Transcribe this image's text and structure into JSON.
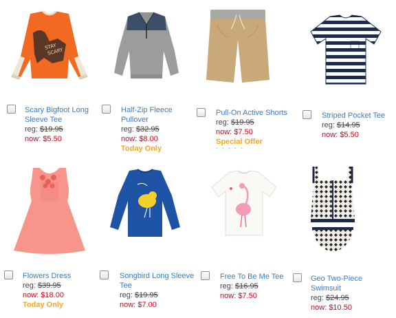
{
  "products": [
    {
      "name": "Scary Bigfoot Long Sleeve Tee",
      "reg_label": "reg:",
      "reg_price": "$19.95",
      "now_label": "now:",
      "now_price": "$5.50",
      "promo": ""
    },
    {
      "name": "Half-Zip Fleece Pullover",
      "reg_label": "reg:",
      "reg_price": "$32.95",
      "now_label": "now:",
      "now_price": "$8.00",
      "promo": "Today Only"
    },
    {
      "name": "Pull-On Active Shorts",
      "reg_label": "reg:",
      "reg_price": "$19.95",
      "now_label": "now:",
      "now_price": "$7.50",
      "promo": "Special Offer"
    },
    {
      "name": "Striped Pocket Tee",
      "reg_label": "reg:",
      "reg_price": "$14.95",
      "now_label": "now:",
      "now_price": "$5.50",
      "promo": ""
    },
    {
      "name": "Flowers Dress",
      "reg_label": "reg:",
      "reg_price": "$39.95",
      "now_label": "now:",
      "now_price": "$18.00",
      "promo": "Today Only"
    },
    {
      "name": "Songbird Long Sleeve Tee",
      "reg_label": "reg:",
      "reg_price": "$19.95",
      "now_label": "now:",
      "now_price": "$7.00",
      "promo": ""
    },
    {
      "name": "Free To Be Me Tee",
      "reg_label": "reg:",
      "reg_price": "$16.95",
      "now_label": "now:",
      "now_price": "$7.50",
      "promo": ""
    },
    {
      "name": "Geo Two-Piece Swimsuit",
      "reg_label": "reg:",
      "reg_price": "$24.95",
      "now_label": "now:",
      "now_price": "$10.50",
      "promo": ""
    }
  ],
  "colors": {
    "link": "#3b7bbf",
    "sale": "#d0021b",
    "promo": "#f5a623"
  }
}
